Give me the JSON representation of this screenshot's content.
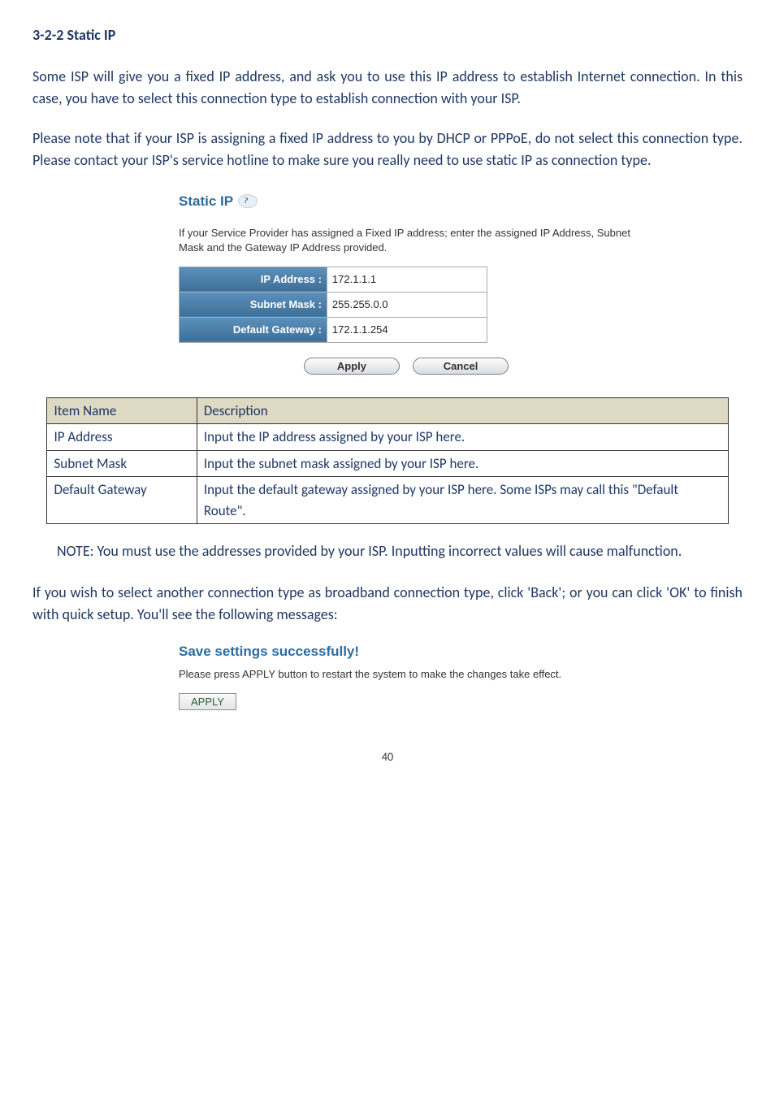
{
  "heading": "3-2-2 Static IP",
  "para1": "Some ISP will give you a fixed IP address, and ask you to use this IP address to establish Internet connection. In this case, you have to select this connection type to establish connection with your ISP.",
  "para2": "Please note that if your ISP is assigning a fixed IP address to you by DHCP or PPPoE, do not select this connection type. Please contact your ISP's service hotline to make sure you really need to use static IP as connection type.",
  "screenshot1": {
    "title": "Static IP",
    "desc": "If your Service Provider has assigned a Fixed IP address; enter the assigned IP Address, Subnet Mask and the Gateway IP Address provided.",
    "rows": [
      {
        "label": "IP Address :",
        "value": "172.1.1.1"
      },
      {
        "label": "Subnet Mask :",
        "value": "255.255.0.0"
      },
      {
        "label": "Default Gateway :",
        "value": "172.1.1.254"
      }
    ],
    "apply": "Apply",
    "cancel": "Cancel"
  },
  "desc_table": {
    "header_name": "Item Name",
    "header_desc": "Description",
    "rows": [
      {
        "name": "IP Address",
        "desc": "Input the IP address assigned by your ISP here."
      },
      {
        "name": "Subnet Mask",
        "desc": "Input the subnet mask assigned by your ISP here."
      },
      {
        "name": "Default Gateway",
        "desc": "Input the default gateway assigned by your ISP here. Some ISPs may call this \"Default Route\"."
      }
    ]
  },
  "note": "NOTE: You must use the addresses provided by your ISP. Inputting incorrect values will cause malfunction.",
  "para3": "If you wish to select another connection type as broadband connection type, click 'Back'; or you can click 'OK' to finish with quick setup. You'll see the following messages:",
  "screenshot2": {
    "title": "Save settings successfully!",
    "desc": "Please press APPLY button to restart the system to make the changes take effect.",
    "apply": "APPLY"
  },
  "page_num": "40"
}
